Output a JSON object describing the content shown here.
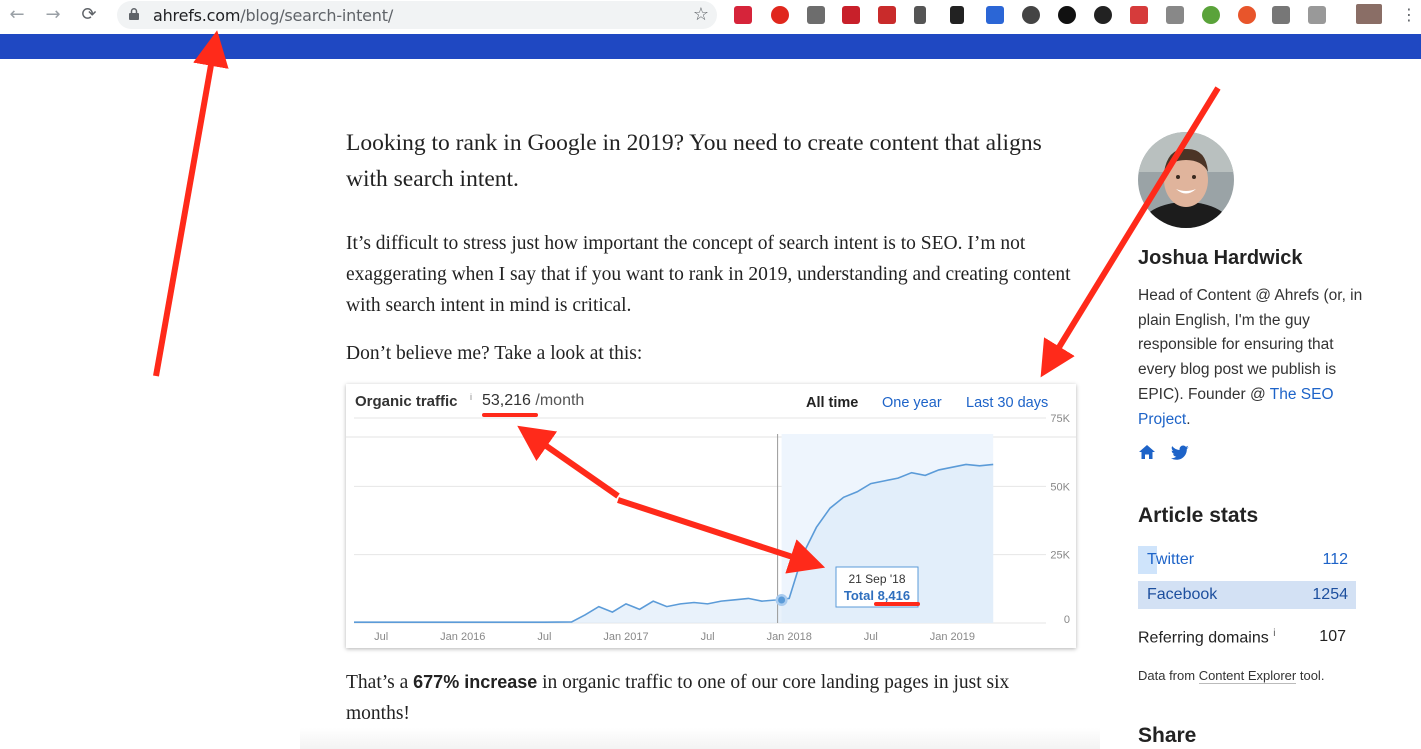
{
  "browser": {
    "url_domain": "ahrefs.com",
    "url_path": "/blog/search-intent/"
  },
  "article": {
    "lead": "Looking to rank in Google in 2019? You need to create content that aligns with search intent.",
    "para1": "It’s difficult to stress just how important the concept of search intent is to SEO. I’m not exaggerating when I say that if you want to rank in 2019, understanding and creating content with search intent in mind is critical.",
    "para2": "Don’t believe me? Take a look at this:",
    "para3_before": "That’s a ",
    "para3_bold": "677% increase",
    "para3_after": " in organic traffic to one of our core landing pages in just six months!"
  },
  "chart_widget": {
    "title": "Organic traffic",
    "info": "i",
    "value": "53,216",
    "unit": "/month",
    "ranges": [
      "All time",
      "One year",
      "Last 30 days"
    ],
    "tooltip_date": "21 Sep '18",
    "tooltip_total": "Total 8,416"
  },
  "chart_data": {
    "type": "area",
    "x_ticks": [
      "Jul",
      "Jan 2016",
      "Jul",
      "Jan 2017",
      "Jul",
      "Jan 2018",
      "Jul",
      "Jan 2019"
    ],
    "y_ticks": [
      "75K",
      "50K",
      "25K",
      "0"
    ],
    "ylim": [
      0,
      75000
    ],
    "grid": true,
    "x_months": [
      0,
      2,
      4,
      6,
      8,
      10,
      12,
      14,
      16,
      17,
      18,
      19,
      20,
      21,
      22,
      23,
      24,
      25,
      26,
      27,
      28,
      29,
      30,
      31,
      32,
      33,
      34,
      35,
      36,
      37,
      38,
      39,
      40,
      41,
      42,
      43,
      44,
      45,
      46,
      47
    ],
    "values": [
      300,
      300,
      300,
      300,
      300,
      300,
      300,
      300,
      400,
      3000,
      6000,
      4000,
      7000,
      5000,
      8000,
      6000,
      7000,
      7500,
      7000,
      8000,
      8500,
      9000,
      8000,
      8416,
      9000,
      25000,
      35000,
      42000,
      46000,
      48000,
      51000,
      52000,
      53000,
      55000,
      54000,
      56000,
      57000,
      58000,
      57500,
      58000
    ],
    "annotation_month": 31,
    "annotation_value": 8416
  },
  "sidebar": {
    "author": "Joshua Hardwick",
    "bio_text": "Head of Content @ Ahrefs (or, in plain English, I'm the guy responsible for ensuring that every blog post we publish is EPIC). Founder @ ",
    "bio_link": "The SEO Project",
    "bio_end": ".",
    "stats_title": "Article stats",
    "twitter_label": "Twitter",
    "twitter_count": "112",
    "facebook_label": "Facebook",
    "facebook_count": "1254",
    "refdomains_label": "Referring domains",
    "refdomains_info": "i",
    "refdomains_count": "107",
    "datafrom_pre": "Data from ",
    "datafrom_link": "Content Explorer",
    "datafrom_post": " tool.",
    "share_title": "Share"
  },
  "colors": {
    "brand_blue": "#1f48c2",
    "link_blue": "#1d63c8",
    "annotation_red": "#ff2a1a"
  }
}
